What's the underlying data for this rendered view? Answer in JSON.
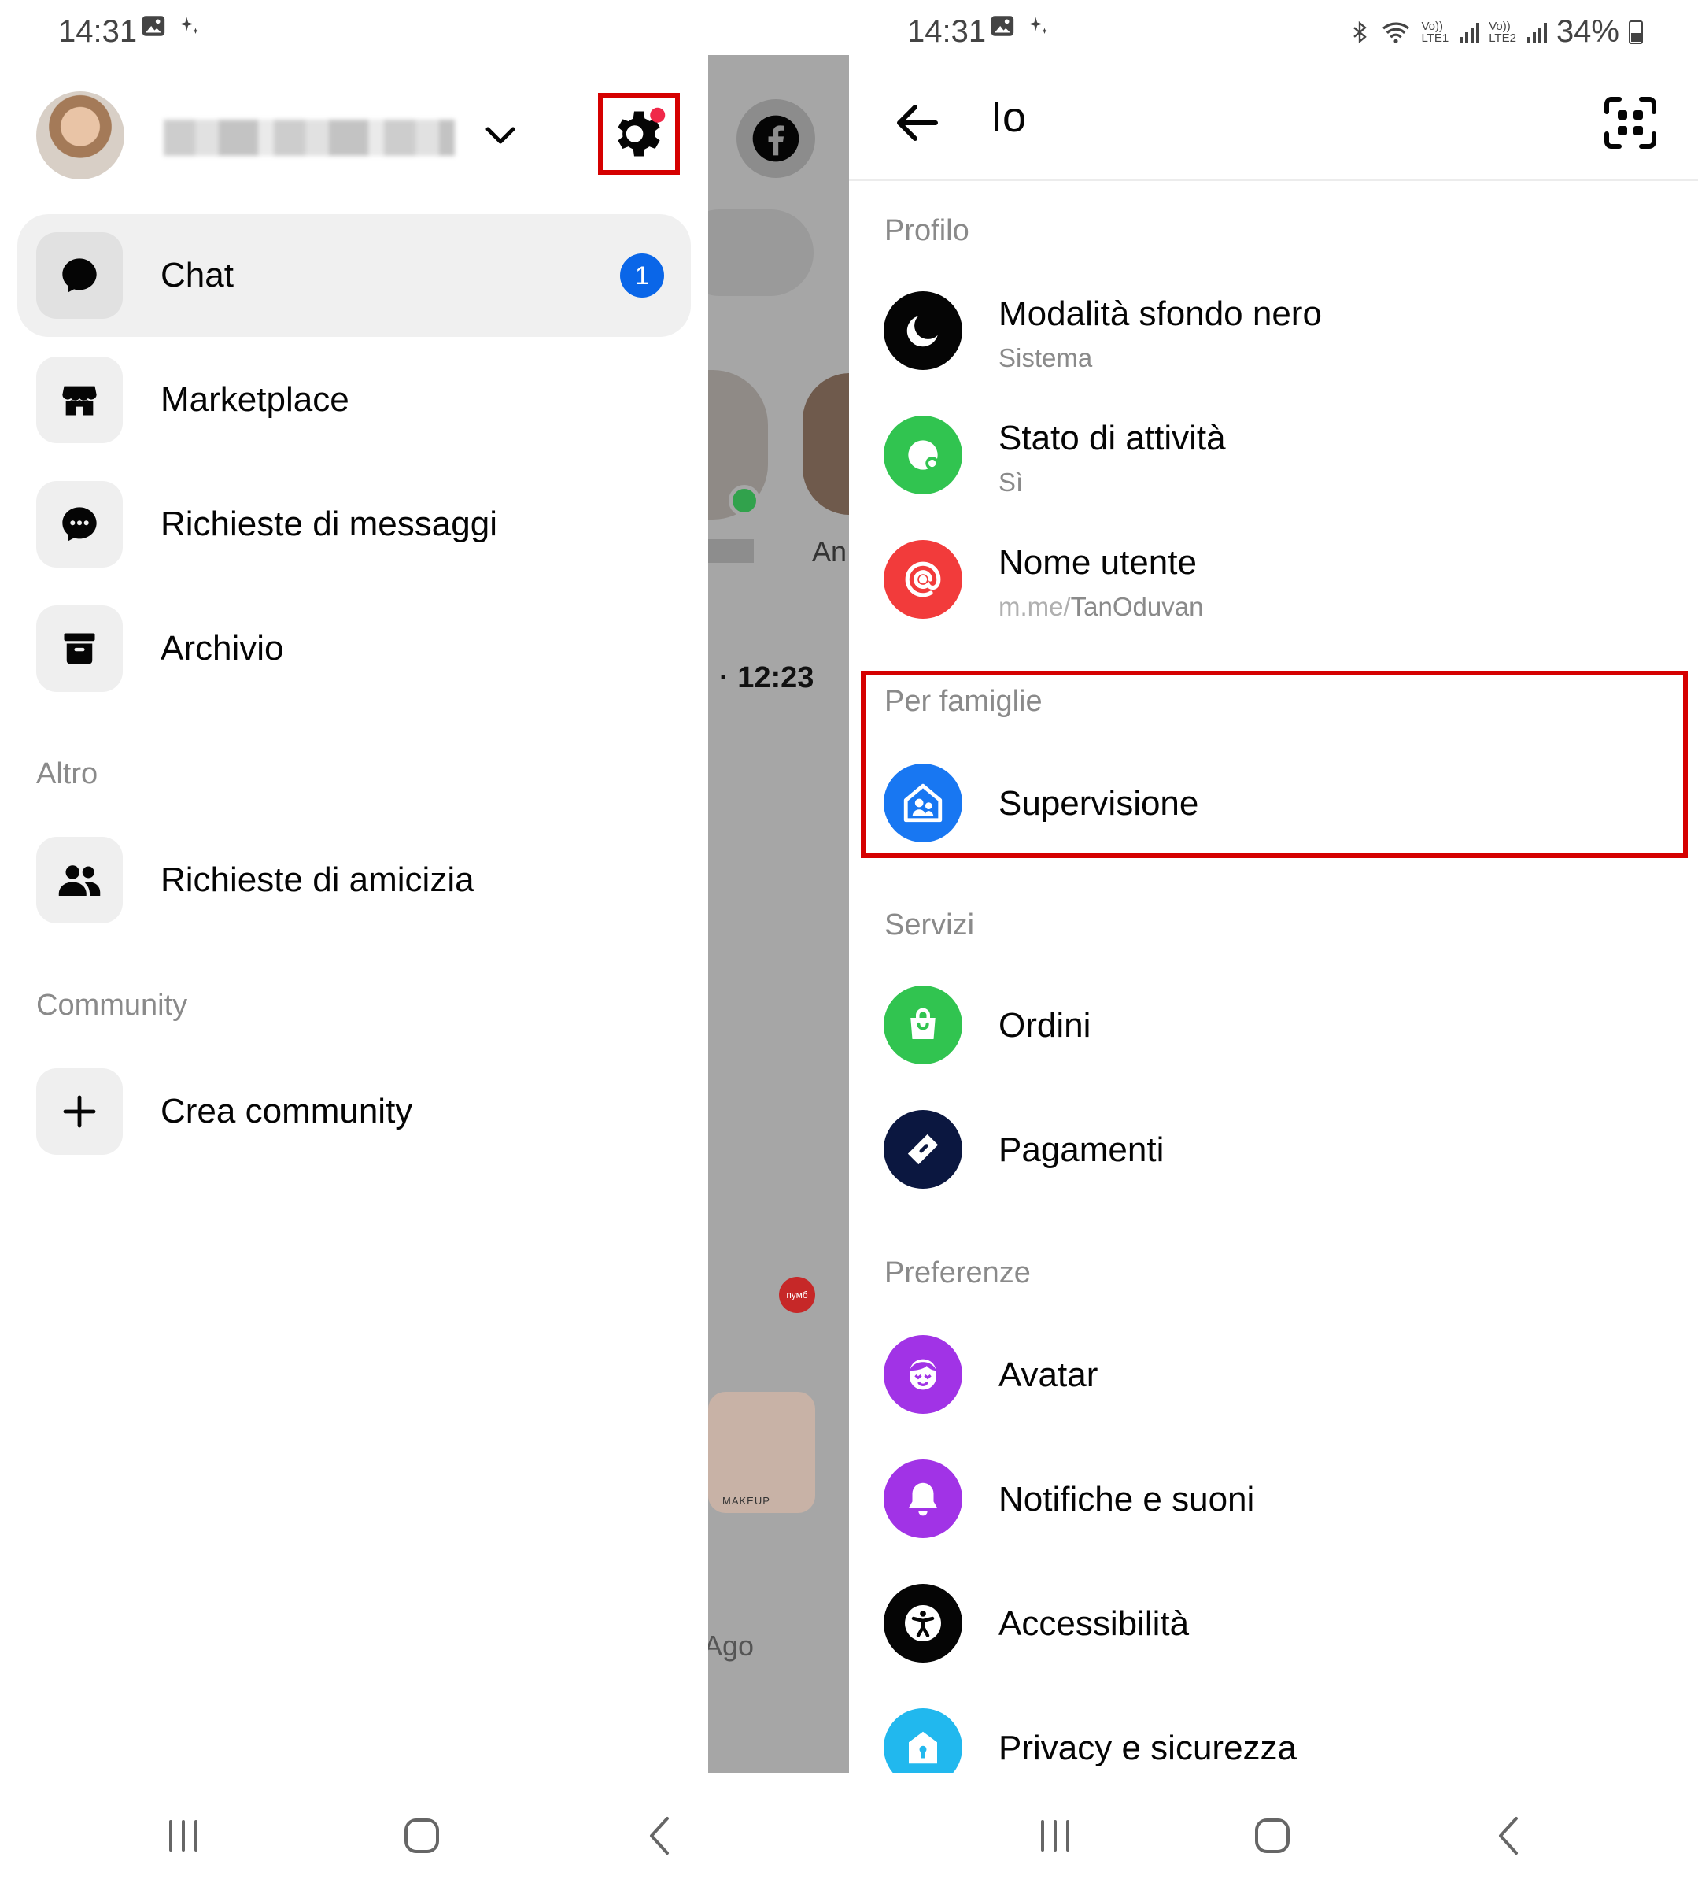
{
  "status_bar": {
    "time": "14:31",
    "battery": "34%",
    "sim1": {
      "top": "Vo))",
      "bottom": "LTE1"
    },
    "sim2": {
      "top": "Vo))",
      "bottom": "LTE2"
    }
  },
  "left": {
    "menu": [
      {
        "label": "Chat",
        "icon": "chat-bubble-icon",
        "badge": "1",
        "active": true
      },
      {
        "label": "Marketplace",
        "icon": "shop-icon"
      },
      {
        "label": "Richieste di messaggi",
        "icon": "message-requests-icon"
      },
      {
        "label": "Archivio",
        "icon": "archive-icon"
      }
    ],
    "section_altro": "Altro",
    "altro_items": [
      {
        "label": "Richieste di amicizia",
        "icon": "friends-icon"
      }
    ],
    "section_community": "Community",
    "community_items": [
      {
        "label": "Crea community",
        "icon": "plus-icon"
      }
    ],
    "overlay": {
      "story_label": "An",
      "time": "· 12:23",
      "red_badge": "пумб",
      "thumb_text": "MAKEUP",
      "bottom_text": "Ago"
    }
  },
  "right": {
    "title": "Io",
    "sections": {
      "profilo": "Profilo",
      "famiglie": "Per famiglie",
      "servizi": "Servizi",
      "preferenze": "Preferenze"
    },
    "profilo_items": [
      {
        "title": "Modalità sfondo nero",
        "subtitle": "Sistema",
        "icon": "moon-icon",
        "color": "#050505"
      },
      {
        "title": "Stato di attività",
        "subtitle": "Sì",
        "icon": "active-status-icon",
        "color": "#31c450"
      },
      {
        "title": "Nome utente",
        "subtitle_prefix": "m.me/",
        "subtitle": "TanOduvan",
        "icon": "at-icon",
        "color": "#f23b3b"
      }
    ],
    "famiglie_items": [
      {
        "title": "Supervisione",
        "icon": "supervision-icon",
        "color": "#1877f2"
      }
    ],
    "servizi_items": [
      {
        "title": "Ordini",
        "icon": "shopping-bag-icon",
        "color": "#31c450"
      },
      {
        "title": "Pagamenti",
        "icon": "payments-icon",
        "color": "#0b1740"
      }
    ],
    "preferenze_items": [
      {
        "title": "Avatar",
        "icon": "avatar-icon",
        "color": "#a133e6"
      },
      {
        "title": "Notifiche e suoni",
        "icon": "bell-icon",
        "color": "#a133e6"
      },
      {
        "title": "Accessibilità",
        "icon": "accessibility-icon",
        "color": "#050505"
      },
      {
        "title": "Privacy e sicurezza",
        "icon": "privacy-icon",
        "color": "#21b8ee"
      }
    ]
  },
  "colors": {
    "highlight": "#d50000",
    "badge": "#0a66e8",
    "overlay": "#a6a6a6"
  }
}
